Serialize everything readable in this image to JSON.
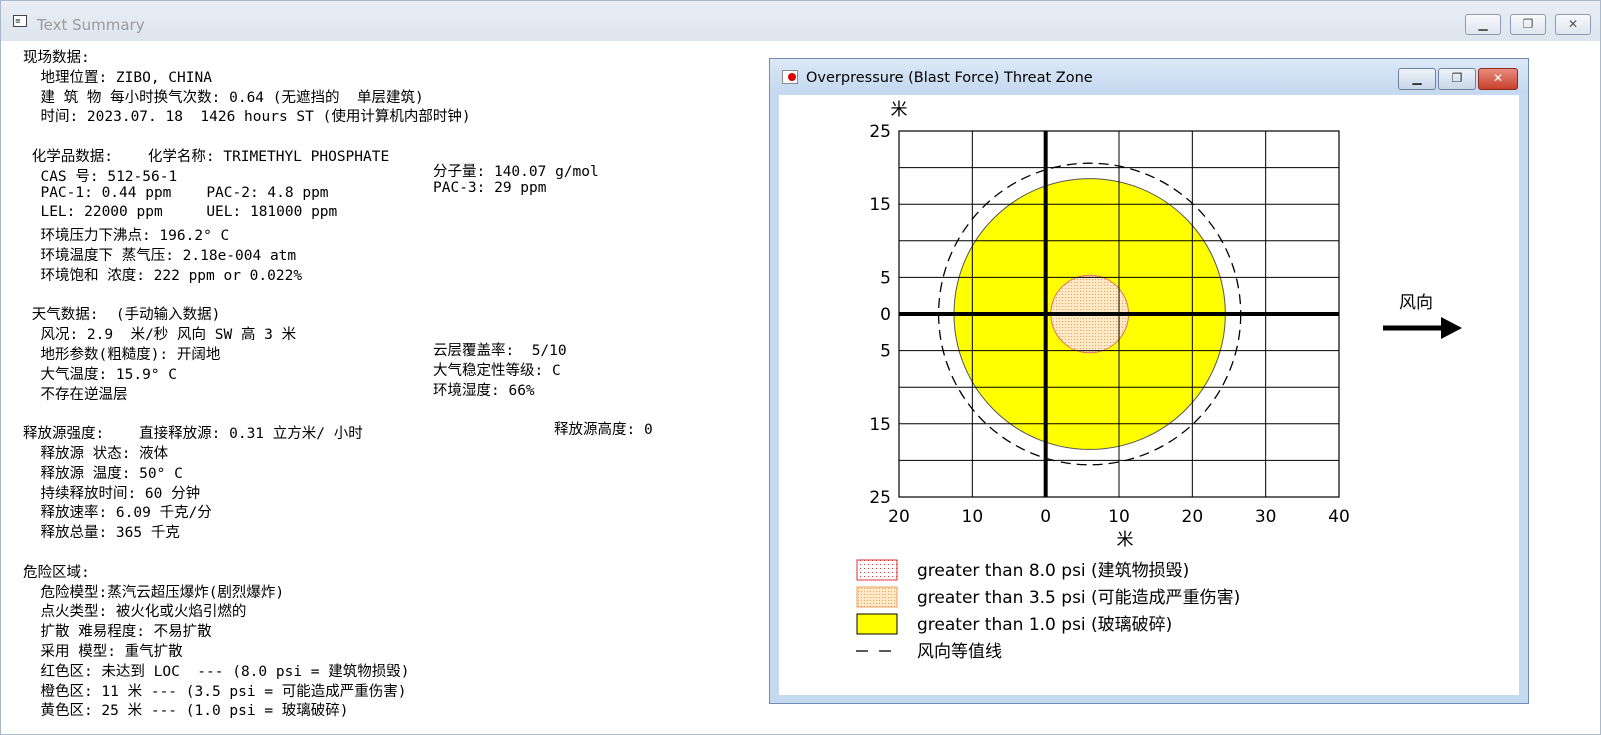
{
  "window": {
    "title": "Text Summary",
    "buttons": [
      "minimize",
      "restore",
      "close"
    ]
  },
  "summary": {
    "lines": [
      "现场数据:",
      "  地理位置: ZIBO, CHINA",
      "  建 筑 物 每小时换气次数: 0.64 (无遮挡的  单层建筑)",
      "  时间: 2023.07. 18  1426 hours ST (使用计算机内部时钟)",
      "",
      " 化学品数据:    化学名称: TRIMETHYL PHOSPHATE",
      "  CAS 号: 512-56-1",
      "  PAC-1: 0.44 ppm    PAC-2: 4.8 ppm",
      "  LEL: 22000 ppm     UEL: 181000 ppm",
      "  环境压力下沸点: 196.2° C",
      "  环境温度下 蒸气压: 2.18e-004 atm",
      "  环境饱和 浓度: 222 ppm or 0.022%",
      "",
      " 天气数据:  (手动输入数据)",
      "  风况: 2.9  米/秒 风向 SW 高 3 米",
      "  地形参数(粗糙度): 开阔地",
      "  大气温度: 15.9° C",
      "  不存在逆温层",
      "",
      "释放源强度:    直接释放源: 0.31 立方米/ 小时",
      "  释放源 状态: 液体",
      "  释放源 温度: 50° C",
      "  持续释放时间: 60 分钟",
      "  释放速率: 6.09 千克/分",
      "  释放总量: 365 千克",
      "",
      "危险区域:",
      "  危险模型:蒸汽云超压爆炸(剧烈爆炸)",
      "  点火类型: 被火化或火焰引燃的",
      "  扩散 难易程度: 不易扩散",
      "  采用 模型: 重气扩散",
      "  红色区: 未达到 LOC  --- (8.0 psi = 建筑物损毁)",
      "  橙色区: 11 米 --- (3.5 psi = 可能造成严重伤害)",
      "  黄色区: 25 米 --- (1.0 psi = 玻璃破碎)"
    ],
    "right_column": {
      "molecular_weight": "分子量: 140.07 g/mol",
      "pac3": "PAC-3: 29 ppm",
      "cloud_cover": "云层覆盖率:  5/10",
      "stability": "大气稳定性等级: C",
      "humidity": "环境湿度: 66%",
      "release_height": "释放源高度: 0"
    }
  },
  "chart_window": {
    "title": "Overpressure (Blast Force) Threat Zone",
    "buttons": [
      "minimize",
      "restore",
      "close"
    ]
  },
  "chart_data": {
    "type": "threat-zone",
    "y_unit": "米",
    "xlabel": "米",
    "x_ticks": [
      20,
      10,
      0,
      10,
      20,
      30,
      40
    ],
    "y_ticks": [
      25,
      15,
      5,
      0,
      5,
      15,
      25
    ],
    "x_range": [
      -20,
      40
    ],
    "y_range": [
      -25,
      25
    ],
    "grid": true,
    "wind_label": "风向",
    "zones": [
      {
        "name": "yellow",
        "radius_m": 18.5,
        "center_x_m": 6,
        "color": "#ffff00"
      },
      {
        "name": "orange",
        "radius_m": 5.3,
        "center_x_m": 6,
        "color": "#ffe2b8"
      }
    ],
    "legend": [
      {
        "swatch": "dotted-red",
        "label": "greater than 8.0 psi (建筑物损毁)"
      },
      {
        "swatch": "dotted-orange",
        "label": "greater than 3.5 psi (可能造成严重伤害)"
      },
      {
        "swatch": "yellow",
        "label": "greater than 1.0 psi (玻璃破碎)"
      },
      {
        "swatch": "dashed",
        "label": "风向等值线"
      }
    ]
  }
}
